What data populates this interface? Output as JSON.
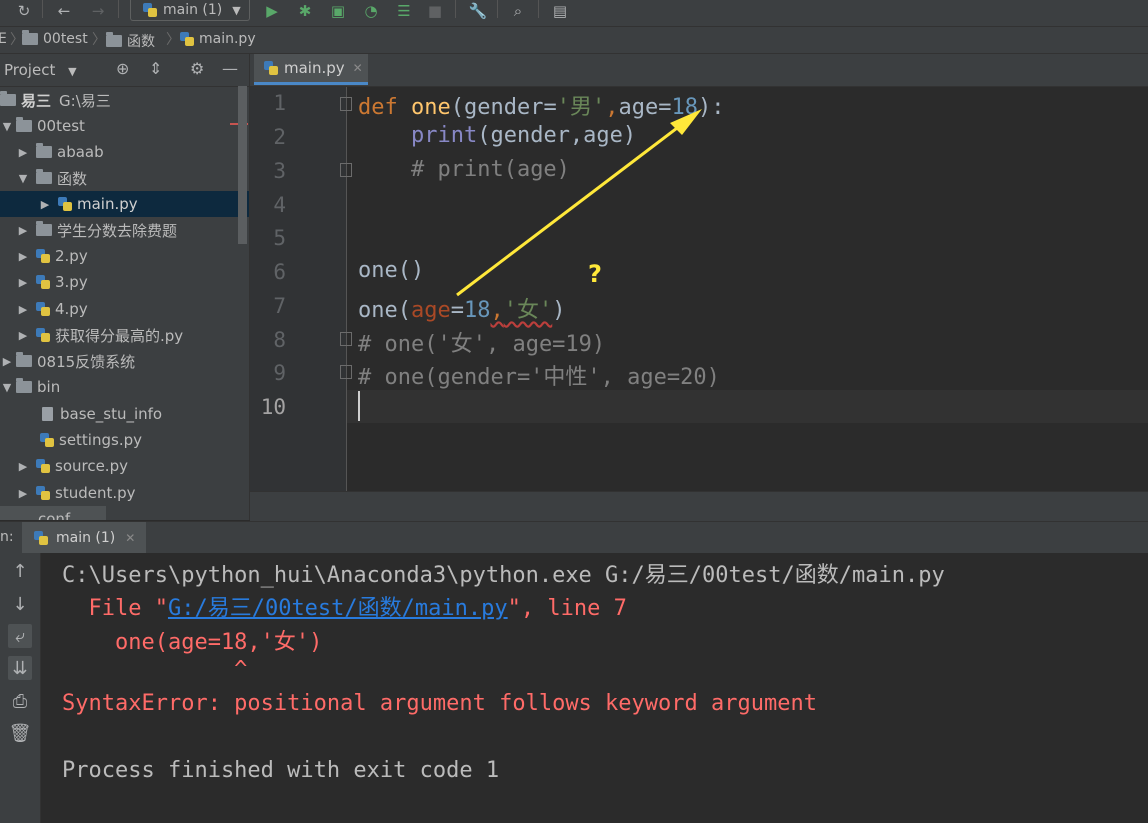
{
  "toolbar": {
    "run_config": "main (1)"
  },
  "navbar": {
    "crumbs": [
      "00test",
      "函数",
      "main.py"
    ],
    "left_stub": "E"
  },
  "project_panel": {
    "title": "Project",
    "tree": [
      {
        "label": "易三",
        "path": "G:\\易三"
      },
      {
        "label": "00test"
      },
      {
        "label": "abaab"
      },
      {
        "label": "函数"
      },
      {
        "label": "main.py"
      },
      {
        "label": "学生分数去除费题"
      },
      {
        "label": "2.py"
      },
      {
        "label": "3.py"
      },
      {
        "label": "4.py"
      },
      {
        "label": "获取得分最高的.py"
      },
      {
        "label": "0815反馈系统"
      },
      {
        "label": "bin"
      },
      {
        "label": "base_stu_info"
      },
      {
        "label": "settings.py"
      },
      {
        "label": "source.py"
      },
      {
        "label": "student.py"
      },
      {
        "label": "conf"
      }
    ]
  },
  "editor": {
    "tab_label": "main.py",
    "line_numbers": [
      "1",
      "2",
      "3",
      "4",
      "5",
      "6",
      "7",
      "8",
      "9",
      "10"
    ],
    "code": {
      "l1": {
        "kw": "def",
        "fn": "one",
        "p1": "(gender=",
        "s1": "'男'",
        "c1": ",",
        "p2": "age=",
        "n1": "18",
        "end": "):"
      },
      "l2": {
        "indent": "    ",
        "builtin": "print",
        "rest": "(gender,age)"
      },
      "l3": {
        "indent": "    ",
        "comment": "# print(age)"
      },
      "l6": {
        "text": "one()"
      },
      "l7": {
        "a": "one(",
        "param": "age",
        "eq": "=",
        "num": "18",
        "comma": ",",
        "str": "'女'",
        "end": ")"
      },
      "l8": {
        "comment": "# one('女', age=19)"
      },
      "l9": {
        "comment": "# one(gender='中性', age=20)"
      }
    },
    "annotation_mark": "?"
  },
  "run": {
    "label": "n:",
    "tab_label": "main (1)",
    "console": {
      "cmd": "C:\\Users\\python_hui\\Anaconda3\\python.exe G:/易三/00test/函数/main.py",
      "file_prefix": "  File \"",
      "file_link": "G:/易三/00test/函数/main.py",
      "file_suffix": "\", line 7",
      "code_line": "    one(age=18,'女')",
      "caret_line": "             ^",
      "error": "SyntaxError: positional argument follows keyword argument",
      "exit": "Process finished with exit code 1"
    }
  },
  "colors": {
    "background": "#2b2b2b",
    "panel": "#3c3f41",
    "keyword": "#cc7832",
    "function": "#ffc66d",
    "string": "#6a8759",
    "number": "#6897bb",
    "comment": "#808080",
    "error": "#ff6b68",
    "link": "#287bde",
    "annotation": "#ffe83a"
  }
}
